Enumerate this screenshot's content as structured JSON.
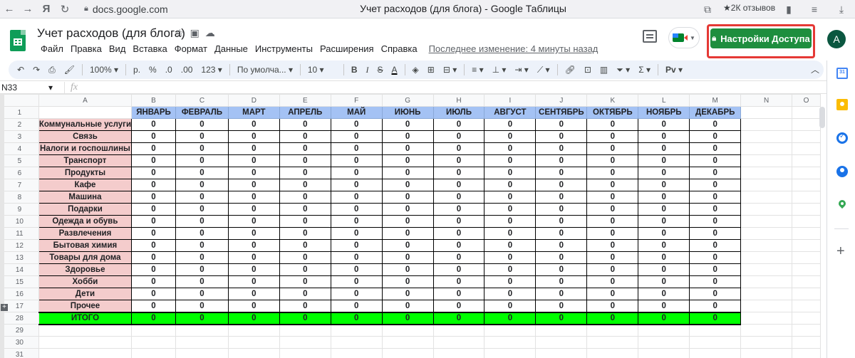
{
  "browser": {
    "url": "docs.google.com",
    "page_title": "Учет расходов (для блога) - Google Таблицы",
    "reviews": "2К отзывов"
  },
  "doc": {
    "title": "Учет расходов (для блога)",
    "menu": [
      "Файл",
      "Правка",
      "Вид",
      "Вставка",
      "Формат",
      "Данные",
      "Инструменты",
      "Расширения",
      "Справка"
    ],
    "last_edit": "Последнее изменение: 4 минуты назад",
    "share_label": "Настройки Доступа",
    "avatar_letter": "A"
  },
  "toolbar": {
    "zoom": "100%",
    "currency": "р.",
    "percent": "%",
    "dec_less": ".0",
    "dec_more": ".00",
    "format_more": "123",
    "font": "По умолча...",
    "font_size": "10",
    "bold": "B",
    "italic": "I",
    "strike": "S",
    "text_color": "A",
    "functions_mark": "Pv"
  },
  "formula_bar": {
    "name_box": "N33",
    "fx": "fx"
  },
  "sheet": {
    "columns": [
      "A",
      "B",
      "C",
      "D",
      "E",
      "F",
      "G",
      "H",
      "I",
      "J",
      "K",
      "L",
      "M",
      "N",
      "O"
    ],
    "months": [
      "ЯНВАРЬ",
      "ФЕВРАЛЬ",
      "МАРТ",
      "АПРЕЛЬ",
      "МАЙ",
      "ИЮНЬ",
      "ИЮЛЬ",
      "АВГУСТ",
      "СЕНТЯБРЬ",
      "ОКТЯБРЬ",
      "НОЯБРЬ",
      "ДЕКАБРЬ"
    ],
    "categories": [
      {
        "row": "2",
        "name": "Коммунальные услуги",
        "values": [
          "0",
          "0",
          "0",
          "0",
          "0",
          "0",
          "0",
          "0",
          "0",
          "0",
          "0",
          "0"
        ]
      },
      {
        "row": "3",
        "name": "Связь",
        "values": [
          "0",
          "0",
          "0",
          "0",
          "0",
          "0",
          "0",
          "0",
          "0",
          "0",
          "0",
          "0"
        ]
      },
      {
        "row": "4",
        "name": "Налоги и госпошлины",
        "values": [
          "0",
          "0",
          "0",
          "0",
          "0",
          "0",
          "0",
          "0",
          "0",
          "0",
          "0",
          "0"
        ]
      },
      {
        "row": "5",
        "name": "Транспорт",
        "values": [
          "0",
          "0",
          "0",
          "0",
          "0",
          "0",
          "0",
          "0",
          "0",
          "0",
          "0",
          "0"
        ]
      },
      {
        "row": "6",
        "name": "Продукты",
        "values": [
          "0",
          "0",
          "0",
          "0",
          "0",
          "0",
          "0",
          "0",
          "0",
          "0",
          "0",
          "0"
        ]
      },
      {
        "row": "7",
        "name": "Кафе",
        "values": [
          "0",
          "0",
          "0",
          "0",
          "0",
          "0",
          "0",
          "0",
          "0",
          "0",
          "0",
          "0"
        ]
      },
      {
        "row": "8",
        "name": "Машина",
        "values": [
          "0",
          "0",
          "0",
          "0",
          "0",
          "0",
          "0",
          "0",
          "0",
          "0",
          "0",
          "0"
        ]
      },
      {
        "row": "9",
        "name": "Подарки",
        "values": [
          "0",
          "0",
          "0",
          "0",
          "0",
          "0",
          "0",
          "0",
          "0",
          "0",
          "0",
          "0"
        ]
      },
      {
        "row": "10",
        "name": "Одежда и обувь",
        "values": [
          "0",
          "0",
          "0",
          "0",
          "0",
          "0",
          "0",
          "0",
          "0",
          "0",
          "0",
          "0"
        ]
      },
      {
        "row": "11",
        "name": "Развлечения",
        "values": [
          "0",
          "0",
          "0",
          "0",
          "0",
          "0",
          "0",
          "0",
          "0",
          "0",
          "0",
          "0"
        ]
      },
      {
        "row": "12",
        "name": "Бытовая химия",
        "values": [
          "0",
          "0",
          "0",
          "0",
          "0",
          "0",
          "0",
          "0",
          "0",
          "0",
          "0",
          "0"
        ]
      },
      {
        "row": "13",
        "name": "Товары для дома",
        "values": [
          "0",
          "0",
          "0",
          "0",
          "0",
          "0",
          "0",
          "0",
          "0",
          "0",
          "0",
          "0"
        ]
      },
      {
        "row": "14",
        "name": "Здоровье",
        "values": [
          "0",
          "0",
          "0",
          "0",
          "0",
          "0",
          "0",
          "0",
          "0",
          "0",
          "0",
          "0"
        ]
      },
      {
        "row": "15",
        "name": "Хобби",
        "values": [
          "0",
          "0",
          "0",
          "0",
          "0",
          "0",
          "0",
          "0",
          "0",
          "0",
          "0",
          "0"
        ]
      },
      {
        "row": "16",
        "name": "Дети",
        "values": [
          "0",
          "0",
          "0",
          "0",
          "0",
          "0",
          "0",
          "0",
          "0",
          "0",
          "0",
          "0"
        ]
      },
      {
        "row": "17",
        "name": "Прочее",
        "values": [
          "0",
          "0",
          "0",
          "0",
          "0",
          "0",
          "0",
          "0",
          "0",
          "0",
          "0",
          "0"
        ]
      }
    ],
    "total": {
      "row": "28",
      "name": "ИТОГО",
      "values": [
        "0",
        "0",
        "0",
        "0",
        "0",
        "0",
        "0",
        "0",
        "0",
        "0",
        "0",
        "0"
      ]
    },
    "header_row": "1",
    "empty_rows": [
      "29",
      "30",
      "31"
    ]
  },
  "colors": {
    "month_header": "#a4c2f4",
    "category_bg": "#f4cccc",
    "total_bg": "#00ff00",
    "share_button": "#1e8e3e",
    "highlight_frame": "#e53935"
  }
}
